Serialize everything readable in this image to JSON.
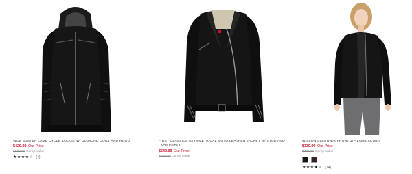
{
  "products": [
    {
      "title": "WCB BUSTER LAMB CYCLE JACKET W/ DIAMOND QUILT AND HOOD",
      "price": "$429.99",
      "price_label": "Our Price",
      "comp_value": "$600.00",
      "comp_label": "Comp Value",
      "rating": 4.5,
      "review_count": "(4)",
      "image_icon": "hooded-leather-jacket"
    },
    {
      "title": "FIRST CLASSICS ASYMMETRICAL MOTO LEATHER JACKET W/ STUD AND LACE DETAIL",
      "price": "$549.99",
      "price_label": "Our Price",
      "comp_value": "$600.00",
      "comp_label": "Comp Value",
      "image_icon": "moto-leather-jacket"
    },
    {
      "title": "WILSONS LEATHER FRONT ZIP LAMB SCUBA",
      "price": "$339.99",
      "price_label": "Our Price",
      "comp_value": "$400.00",
      "comp_label": "Comp Value",
      "rating": 4,
      "review_count": "(74)",
      "swatch_colors": [
        "#151515",
        "#3a2420"
      ],
      "image_icon": "model-wearing-leather-jacket"
    }
  ]
}
